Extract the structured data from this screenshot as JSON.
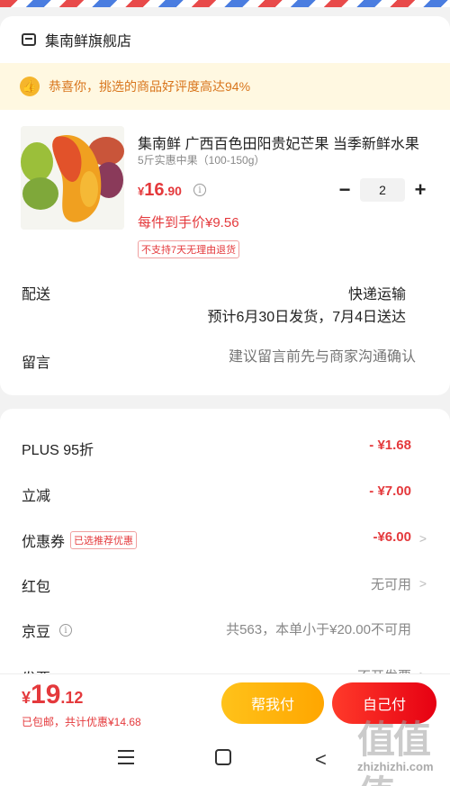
{
  "store": {
    "name": "集南鲜旗舰店",
    "icon": "store-icon"
  },
  "praise_banner": {
    "text": "恭喜你，挑选的商品好评度高达94%",
    "icon": "thumbs-up-icon"
  },
  "product": {
    "title": "集南鲜   广西百色田阳贵妃芒果 当季新鲜水果",
    "spec": "5斤实惠中果（100-150g）",
    "price_currency": "¥",
    "price_int": "16",
    "price_dec": ".90",
    "per_unit_price": "每件到手价¥9.56",
    "return_policy": "不支持7天无理由退货",
    "quantity": "2",
    "minus_label": "−",
    "plus_label": "+"
  },
  "delivery": {
    "label": "配送",
    "method": "快递运输",
    "time": "预计6月30日发货，7月4日送达"
  },
  "remark": {
    "label": "留言",
    "placeholder": "建议留言前先与商家沟通确认"
  },
  "discounts": {
    "plus": {
      "label": "PLUS 95折",
      "value": "- ¥1.68"
    },
    "instant": {
      "label": "立减",
      "value": "- ¥7.00"
    },
    "coupon": {
      "label": "优惠券",
      "tag": "已选推荐优惠",
      "value": "-¥6.00"
    },
    "red_packet": {
      "label": "红包",
      "value": "无可用"
    },
    "jd_beans": {
      "label": "京豆",
      "value": "共563，本单小于¥20.00不可用"
    },
    "invoice": {
      "label": "发票",
      "value": "不开发票"
    }
  },
  "checkout": {
    "total_currency": "¥",
    "total_int": "19",
    "total_dec": ".12",
    "subtitle": "已包邮，共计优惠¥14.68",
    "friend_pay": "帮我付",
    "self_pay": "自己付"
  },
  "watermark": {
    "glyphs": "值值值",
    "url": "zhizhizhi.com"
  },
  "colors": {
    "accent": "#e4393c",
    "praise_bg": "#fff8e1",
    "praise_text": "#d8751c",
    "friend_btn": "#ffb30f",
    "self_btn": "#f2271c"
  }
}
